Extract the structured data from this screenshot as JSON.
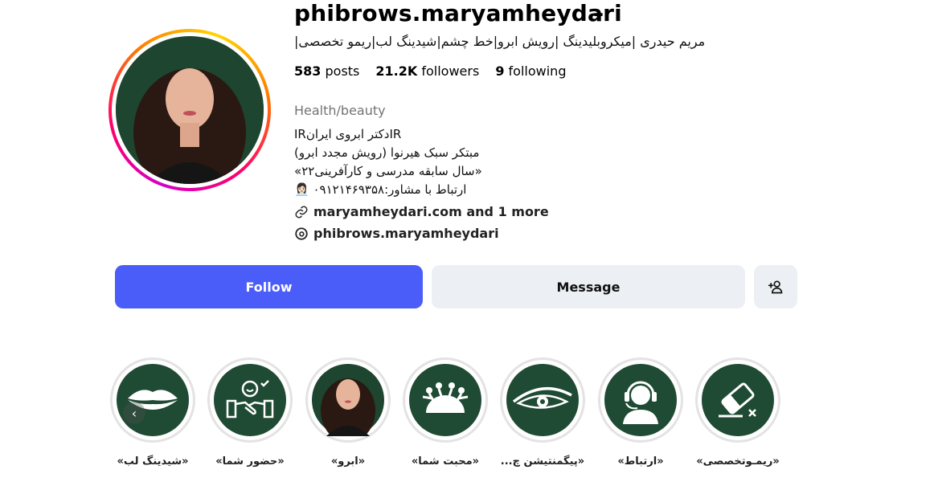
{
  "profile": {
    "username": "phibrows.maryamheydari",
    "more_icon": "⋯",
    "full_name": "مریم حیدری |میکروبلیدینگ |رویش ابرو|خط چشم|شیدینگ لب|ریمو تخصصی|",
    "stats": {
      "posts_count": "583",
      "posts_label": "posts",
      "followers_count": "21.2K",
      "followers_label": "followers",
      "following_count": "9",
      "following_label": "following"
    },
    "category": "Health/beauty",
    "bio": [
      "IRدکتر ابروی ایرانIR",
      "مبتکر سبک هیرنوا (رویش مجدد ابرو)",
      "«سال سابقه مدرسی و کارآفرینی۲۲»",
      "ارتباط با مشاور:۰۹۱۲۱۴۶۹۳۵۸ 👩🏻‍💼"
    ],
    "link": "maryamheydari.com and 1 more",
    "threads": "phibrows.maryamheydari"
  },
  "buttons": {
    "follow": "Follow",
    "message": "Message"
  },
  "highlights": [
    {
      "label": "«شیدینگ لب»",
      "icon": "lips-icon"
    },
    {
      "label": "«حضور شما»",
      "icon": "handshake-icon"
    },
    {
      "label": "«ابرو»",
      "icon": "portrait-photo"
    },
    {
      "label": "«محبت شما»",
      "icon": "people-circle-icon"
    },
    {
      "label": "«پیگمنتیشن چ...",
      "icon": "eye-icon"
    },
    {
      "label": "«ارتباط»",
      "icon": "headset-icon"
    },
    {
      "label": "«ریمـوتخصصی»",
      "icon": "eraser-icon"
    }
  ],
  "colors": {
    "follow_bg": "#4a5df9",
    "highlight_bg": "#1f4a33",
    "secondary_btn_bg": "#eceff3"
  }
}
